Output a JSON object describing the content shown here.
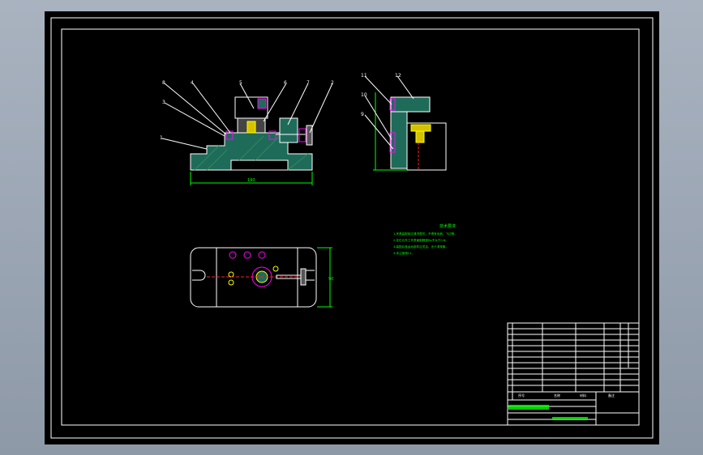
{
  "drawing": {
    "background": "#000000",
    "colors": {
      "outline": "#ffffff",
      "body_fill": "#1f6b5a",
      "hatch": "#2e8b57",
      "dimension": "#00ff00",
      "magenta": "#ff00ff",
      "yellow": "#ffff00",
      "red": "#ff2020",
      "white": "#ffffff",
      "leader": "#ffffff"
    },
    "front_view": {
      "balloons": [
        "8",
        "4",
        "5",
        "3",
        "6",
        "7",
        "2",
        "1"
      ],
      "dimension_text": "190"
    },
    "side_view": {
      "balloons": [
        "11",
        "12",
        "10",
        "9"
      ]
    },
    "top_view": {
      "dimension_text": "90"
    },
    "technical_requirements": {
      "title": "技术要求",
      "lines": [
        "1.夹具装配前应清洗零件，不得有毛刺、飞边等。",
        "2.定位元件工作表面粗糙度Ra不大于0.8。",
        "3.装配后各运动部件应灵活、无卡滞现象。",
        "4.未注倒角C1。"
      ]
    },
    "title_block": {
      "rows": 11,
      "bottom_labels": [
        "序号",
        "名称",
        "材料",
        "备注"
      ]
    }
  }
}
